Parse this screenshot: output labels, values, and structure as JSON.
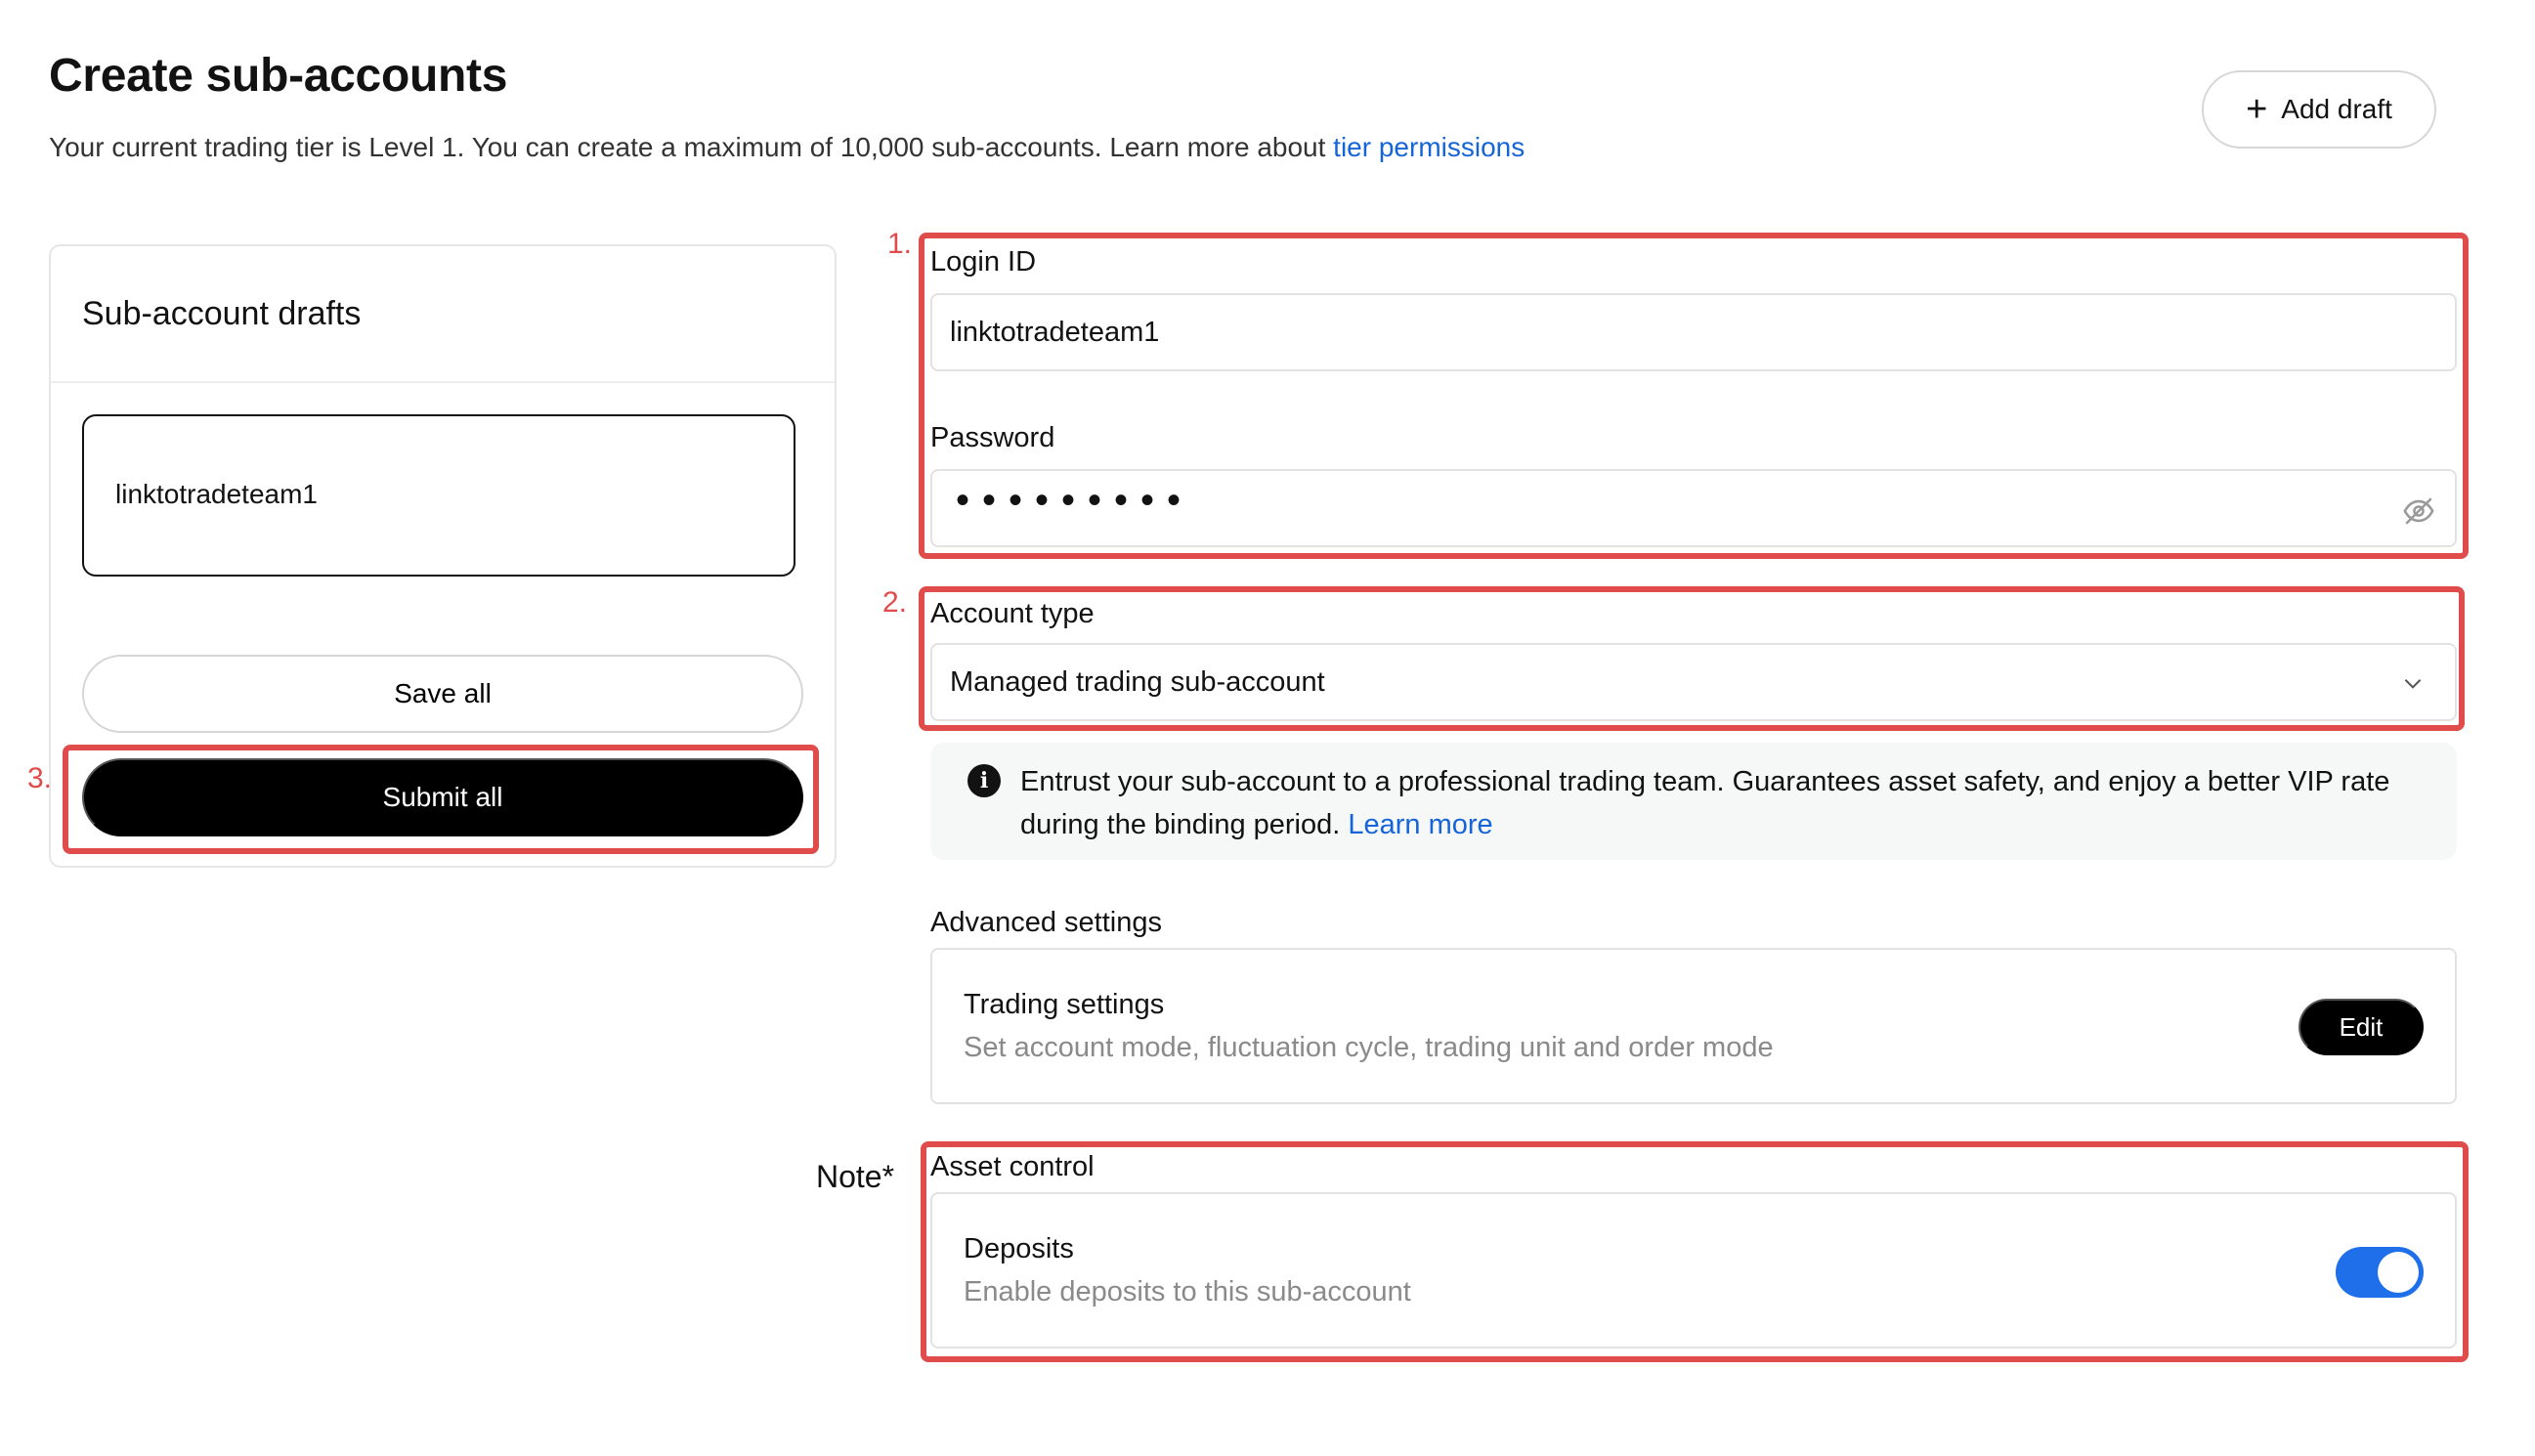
{
  "header": {
    "title": "Create sub-accounts",
    "subtitle": "Your current trading tier is Level 1. You can create a maximum of 10,000 sub-accounts. Learn more about ",
    "subtitle_link": "tier permissions",
    "add_draft_label": "Add draft",
    "add_draft_icon": "plus-icon"
  },
  "drafts": {
    "title": "Sub-account drafts",
    "items": [
      {
        "label": "linktotradeteam1"
      }
    ],
    "save_all_label": "Save all",
    "submit_all_label": "Submit all"
  },
  "annotations": {
    "step1": "1.",
    "step2": "2.",
    "step3": "3.",
    "note": "Note*",
    "box_color": "#e04b4b"
  },
  "form": {
    "login_id": {
      "label": "Login ID",
      "value": "linktotradeteam1"
    },
    "password": {
      "label": "Password",
      "value_masked": "•••••••••",
      "visibility_icon": "eye-off-icon"
    },
    "account_type": {
      "label": "Account type",
      "value": "Managed trading sub-account",
      "icon": "chevron-down-icon"
    },
    "info": {
      "icon": "info-icon",
      "text": "Entrust your sub-account to a professional trading team. Guarantees asset safety, and enjoy a better VIP rate during the binding period. ",
      "link": "Learn more"
    },
    "advanced": {
      "label": "Advanced settings",
      "trading_title": "Trading settings",
      "trading_desc": "Set account mode, fluctuation cycle, trading unit and order mode",
      "edit_label": "Edit"
    },
    "asset_control": {
      "label": "Asset control",
      "deposits_title": "Deposits",
      "deposits_desc": "Enable deposits to this sub-account",
      "deposits_enabled": true
    }
  },
  "colors": {
    "accent_link": "#1565d8",
    "toggle_on": "#1f6feb",
    "primary_button": "#000000"
  }
}
